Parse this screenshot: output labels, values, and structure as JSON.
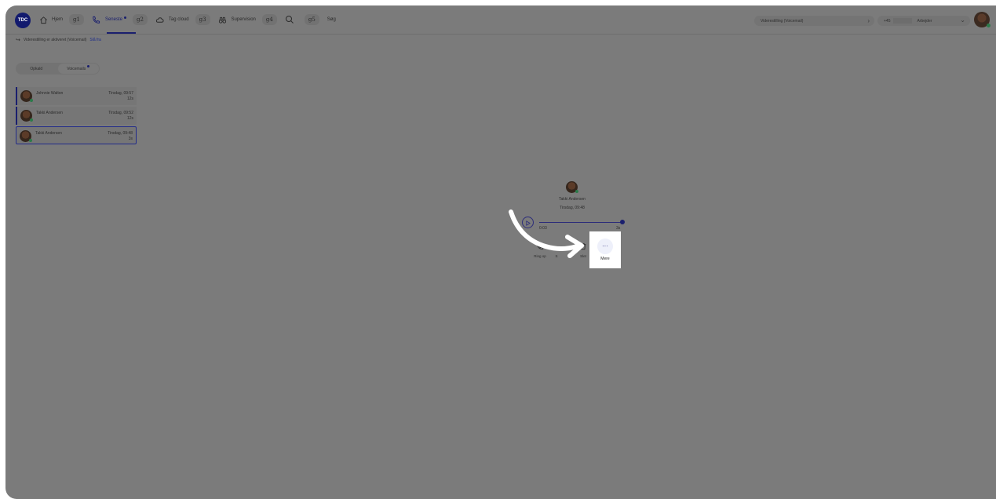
{
  "app": {
    "logo_text": "TDC"
  },
  "nav": {
    "items": [
      {
        "label": "Hjem",
        "shortcut": "g1",
        "icon": "home-icon"
      },
      {
        "label": "Seneste",
        "shortcut": "g2",
        "icon": "phone-icon",
        "active": true,
        "badge": true
      },
      {
        "label": "Tag cloud",
        "shortcut": "g3",
        "icon": "cloud-icon"
      },
      {
        "label": "Supervision",
        "shortcut": "g4",
        "icon": "binoculars-icon"
      },
      {
        "label": "Søg",
        "shortcut": "g5",
        "icon": "search-icon"
      }
    ]
  },
  "header": {
    "forwarding_select": "Viderestilling (Voicemail)",
    "phone_prefix": "+45",
    "status_label": "Arbejder"
  },
  "banner": {
    "text": "Viderestilling er aktiveret (Voicemail)",
    "action": "Slå fra"
  },
  "tabs": [
    {
      "label": "Opkald",
      "active": false
    },
    {
      "label": "Voicemails",
      "active": true,
      "badge": true
    }
  ],
  "voicemails": [
    {
      "name": "Johnnie Walton",
      "time": "Tirsdag, 09:57",
      "duration": "12s"
    },
    {
      "name": "Takki Andersen",
      "time": "Tirsdag, 09:52",
      "duration": "12s"
    },
    {
      "name": "Takki Andersen",
      "time": "Tirsdag, 09:48",
      "duration": "3s",
      "selected": true
    }
  ],
  "detail": {
    "name": "Takki Andersen",
    "time": "Tirsdag, 09:48",
    "position": "0:03",
    "length": "3s",
    "progress_fraction": 1.0,
    "actions": {
      "call": "Ring op",
      "partial": "S",
      "delete": "Slet",
      "more": "Mere"
    }
  },
  "colors": {
    "overlay": "#7b7b7b",
    "accent": "#1a1f6e",
    "highlight": "#ffffff"
  }
}
